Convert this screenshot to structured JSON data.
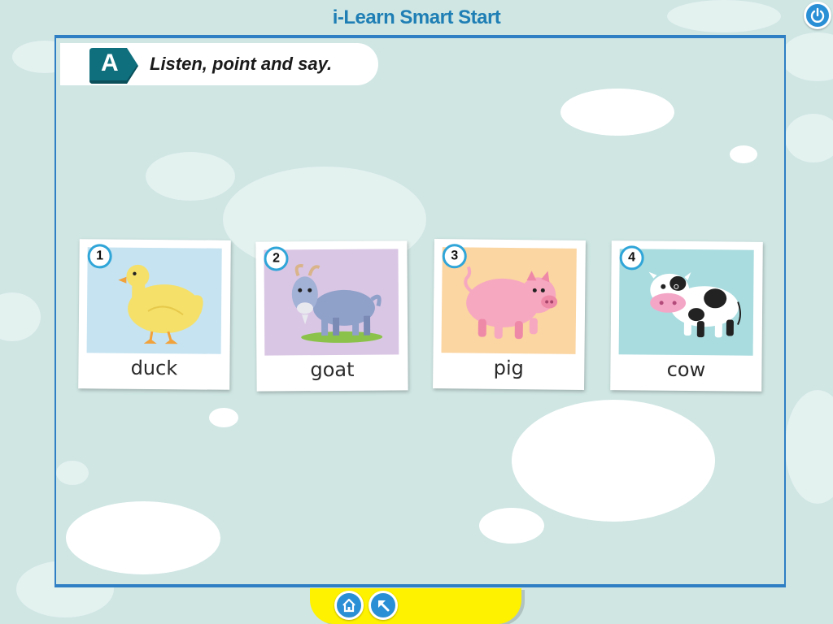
{
  "app": {
    "title": "i-Learn Smart Start"
  },
  "header": {
    "power_icon": "power-icon"
  },
  "activity": {
    "badge_letter": "A",
    "instruction": "Listen, point and say."
  },
  "cards": [
    {
      "number": "1",
      "word": "duck",
      "image": "duck-image",
      "bg": "#c5e3f1"
    },
    {
      "number": "2",
      "word": "goat",
      "image": "goat-image",
      "bg": "#d9c6e4"
    },
    {
      "number": "3",
      "word": "pig",
      "image": "pig-image",
      "bg": "#fbd5a2"
    },
    {
      "number": "4",
      "word": "cow",
      "image": "cow-image",
      "bg": "#a9dcdf"
    }
  ],
  "footer": {
    "buttons": [
      {
        "icon": "home-icon"
      },
      {
        "icon": "back-arrow-icon"
      }
    ]
  },
  "colors": {
    "accent": "#2b8fd6",
    "title": "#1f7fb5",
    "background": "#cfe6e3",
    "footer": "#fff200",
    "badge": "#0f6f7d"
  }
}
